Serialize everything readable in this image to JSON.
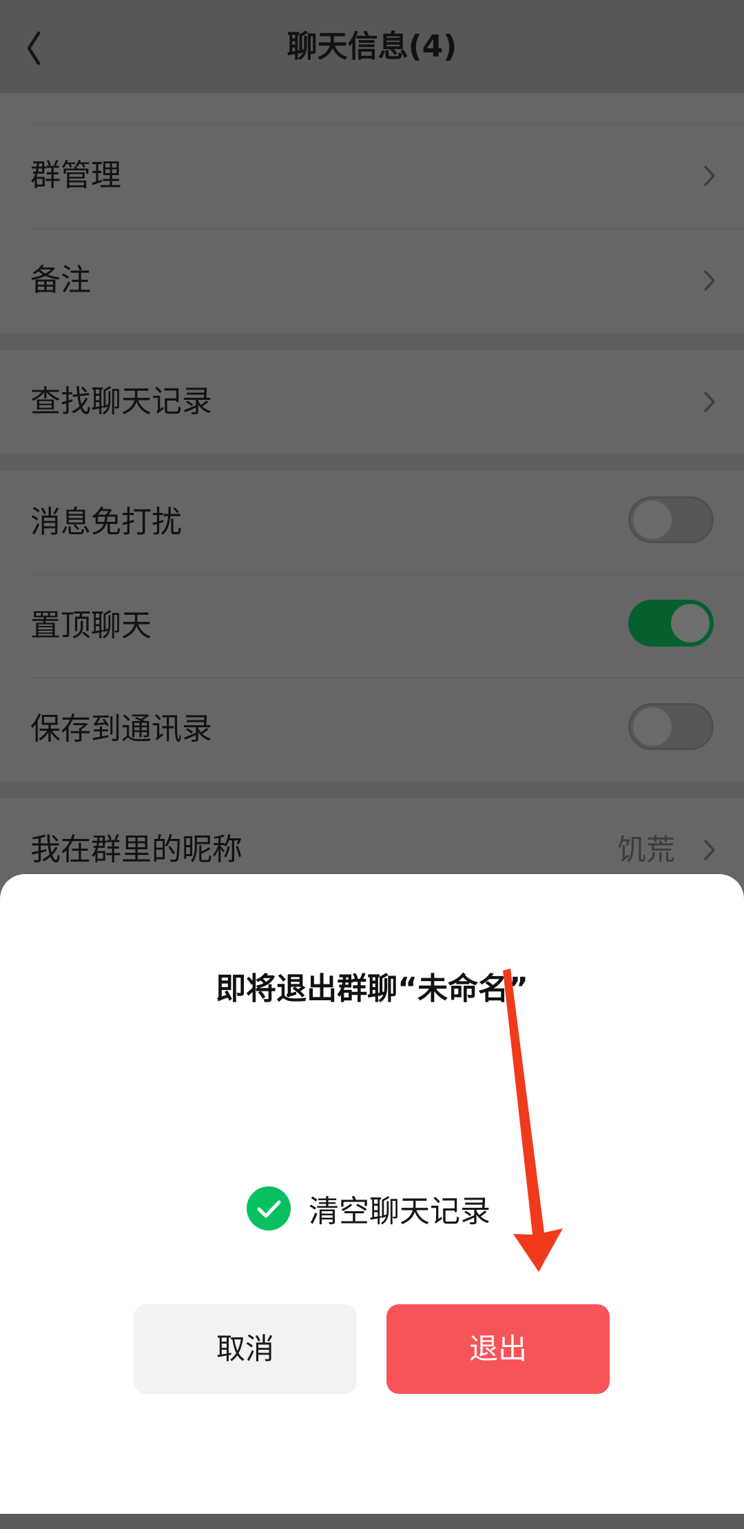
{
  "navbar": {
    "title": "聊天信息(4)"
  },
  "settings": {
    "group_manage": "群管理",
    "remark": "备注",
    "search_history": "查找聊天记录",
    "mute": "消息免打扰",
    "pin": "置顶聊天",
    "save_contacts": "保存到通讯录",
    "group_nickname": "我在群里的昵称",
    "group_nickname_value": "饥荒"
  },
  "toggles": {
    "mute": false,
    "pin": true,
    "save_contacts": false
  },
  "dialog": {
    "title": "即将退出群聊“未命名”",
    "clear_history_label": "清空聊天记录",
    "clear_history_checked": true,
    "cancel_label": "取消",
    "exit_label": "退出"
  },
  "colors": {
    "accent_green": "#07c160",
    "exit_red": "#f7545a",
    "annotation_arrow": "#f03a1c"
  },
  "icons": [
    "back-arrow-icon",
    "chevron-right-icon",
    "check-circle-icon"
  ]
}
